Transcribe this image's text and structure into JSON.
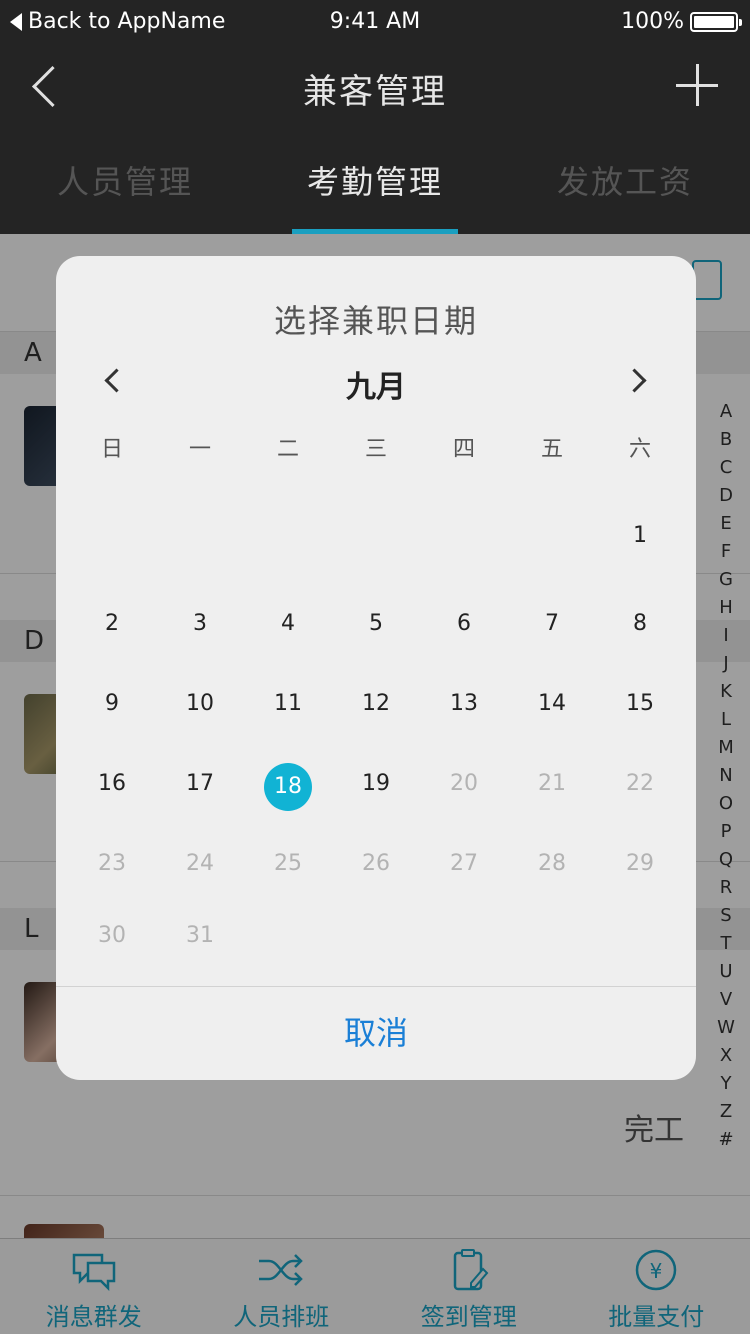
{
  "status_bar": {
    "back_app": "Back to AppName",
    "time": "9:41 AM",
    "battery": "100%"
  },
  "nav": {
    "title": "兼客管理"
  },
  "tabs": [
    {
      "label": "人员管理",
      "active": false
    },
    {
      "label": "考勤管理",
      "active": true
    },
    {
      "label": "发放工资",
      "active": false
    }
  ],
  "list": {
    "sections": [
      "A",
      "D",
      "L"
    ],
    "action_label": "完工"
  },
  "index_letters": [
    "A",
    "B",
    "C",
    "D",
    "E",
    "F",
    "G",
    "H",
    "I",
    "J",
    "K",
    "L",
    "M",
    "N",
    "O",
    "P",
    "Q",
    "R",
    "S",
    "T",
    "U",
    "V",
    "W",
    "X",
    "Y",
    "Z",
    "#"
  ],
  "bottom_tabs": [
    {
      "label": "消息群发",
      "icon": "chat-icon"
    },
    {
      "label": "人员排班",
      "icon": "shuffle-icon"
    },
    {
      "label": "签到管理",
      "icon": "clipboard-icon"
    },
    {
      "label": "批量支付",
      "icon": "yen-icon"
    }
  ],
  "dialog": {
    "title": "选择兼职日期",
    "month": "九月",
    "weekdays": [
      "日",
      "一",
      "二",
      "三",
      "四",
      "五",
      "六"
    ],
    "first_weekday_index": 6,
    "days_in_month": 31,
    "selected_day": "18",
    "last_enabled_day": 19,
    "cancel_label": "取消"
  },
  "colors": {
    "accent": "#11b3d4",
    "cancel_blue": "#1a7fd6",
    "topbar": "#242424"
  }
}
